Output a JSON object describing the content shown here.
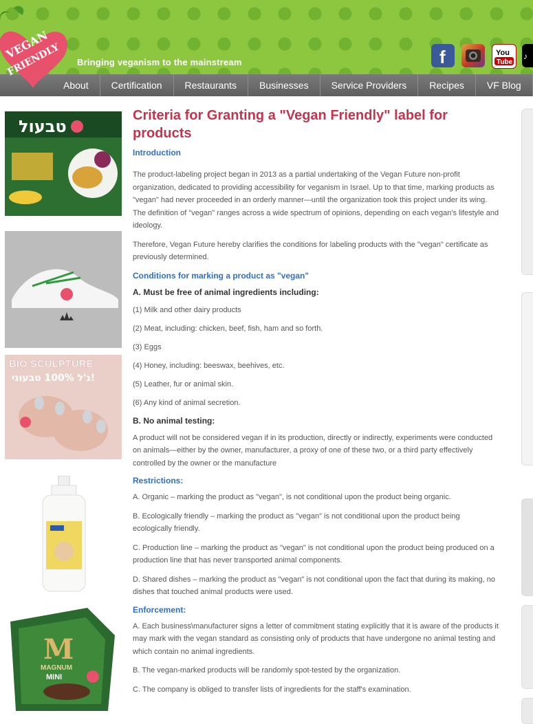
{
  "header": {
    "logo_text_line1": "VEGAN",
    "logo_text_line2": "FRIENDLY",
    "tagline": "Bringing veganism to the mainstream",
    "social": {
      "facebook_icon": "facebook-icon",
      "instagram_icon": "instagram-icon",
      "youtube_label_top": "You",
      "youtube_label_bottom": "Tube",
      "tiktok_icon": "tiktok-icon"
    }
  },
  "nav": {
    "items": [
      "About",
      "Certification",
      "Restaurants",
      "Businesses",
      "Service Providers",
      "Recipes",
      "VF Blog"
    ]
  },
  "left_images": {
    "img1_brand": "טבעול",
    "img3_line1": "BIO SCULPTURE",
    "img3_line2": "ג'ל 100% טבעוני!",
    "img5_brand": "MAGNUM",
    "img5_sub": "MINI"
  },
  "article": {
    "title": "Criteria for Granting a \"Vegan Friendly\" label for products",
    "intro_heading": "Introduction",
    "intro_p1": "The product-labeling project began in 2013 as a partial undertaking of the Vegan Future non-profit organization, dedicated to providing accessibility for veganism in Israel. Up to that time, marking products as \"vegan\" had never proceeded in an orderly manner—until the organization took this project under its wing. The definition of \"vegan\" ranges across a wide spectrum of opinions, depending on each vegan's lifestyle and ideology.",
    "intro_p2": "Therefore, Vegan Future hereby clarifies the conditions for labeling products with the \"vegan\" certificate as previously determined.",
    "conditions_heading": "Conditions for marking a product as \"vegan\"",
    "cond_a_title": "A. Must be free of animal ingredients including:",
    "cond_a_items": [
      "(1) Milk and other dairy products",
      "(2) Meat, including: chicken, beef, fish, ham and so forth.",
      "(3) Eggs",
      "(4) Honey, including: beeswax, beehives, etc.",
      "(5) Leather, fur or animal skin.",
      "(6) Any kind of animal secretion."
    ],
    "cond_b_title": "B. No animal testing:",
    "cond_b_text": "A product will not be considered vegan if in its production, directly or indirectly, experiments were conducted on animals—either by the owner, manufacturer, a proxy of one of these two, or a third party effectively controlled by the owner or the manufacture",
    "restrictions_heading": "Restrictions:",
    "restrictions": [
      "A. Organic – marking the product as \"vegan\", is not conditional upon the product being organic.",
      "B. Ecologically friendly – marking the product as \"vegan\" is not conditional upon the product being ecologically friendly.",
      "C. Production line – marking the product as \"vegan\" is not conditional upon the product being produced on a production line that has never transported animal components.",
      "D. Shared dishes – marking the product as \"vegan\" is not conditional upon the fact that during its making, no dishes that touched animal products were used."
    ],
    "enforcement_heading": "Enforcement:",
    "enforcement": [
      "A. Each business\\manufacturer signs a letter of commitment stating explicitly that it is aware of the products it may mark with the vegan standard as consisting only of products that have undergone no animal testing and which contain no animal ingredients.",
      "B. The vegan-marked products will be randomly spot-tested by the organization.",
      "C. The company is obliged to transfer lists of ingredients for the staff's examination."
    ]
  },
  "colors": {
    "header_green": "#8dc63f",
    "title_red": "#c4344d",
    "heading_blue": "#2e6ec9",
    "nav_gray": "#666666"
  }
}
